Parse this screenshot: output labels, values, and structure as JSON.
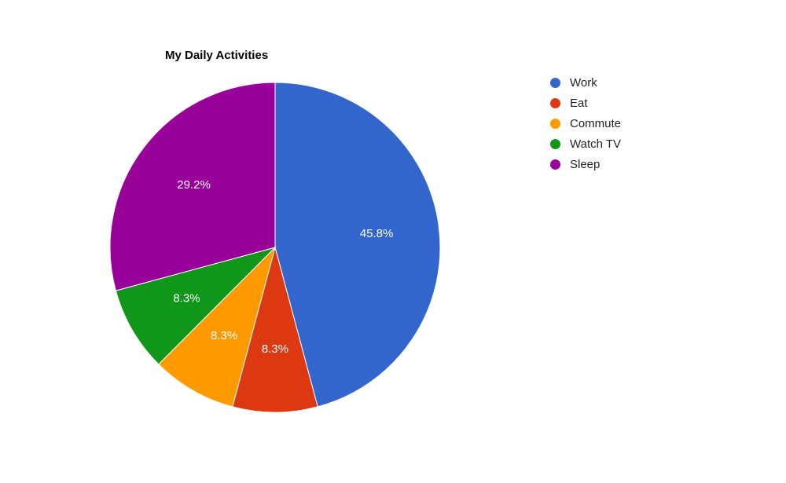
{
  "chart_data": {
    "type": "pie",
    "title": "My Daily Activities",
    "series": [
      {
        "name": "Work",
        "value": 45.8,
        "label": "45.8%",
        "color": "#3366cc"
      },
      {
        "name": "Eat",
        "value": 8.3,
        "label": "8.3%",
        "color": "#dc3912"
      },
      {
        "name": "Commute",
        "value": 8.3,
        "label": "8.3%",
        "color": "#ff9900"
      },
      {
        "name": "Watch TV",
        "value": 8.3,
        "label": "8.3%",
        "color": "#109618"
      },
      {
        "name": "Sleep",
        "value": 29.2,
        "label": "29.2%",
        "color": "#990099"
      }
    ],
    "legend_position": "right"
  }
}
